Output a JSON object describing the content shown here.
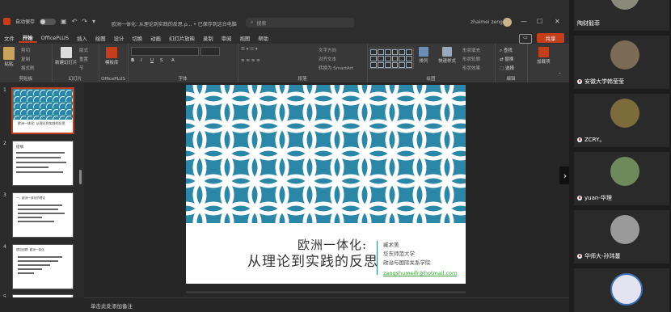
{
  "titlebar": {
    "autosave_label": "自动保存",
    "toggle_state": "关",
    "undo_icon": "undo-icon",
    "redo_icon": "redo-icon",
    "doc_title": "欧洲一体化: 从理论到实践的反思.p... • 已保存到这台电脑",
    "search_placeholder": "搜索",
    "user_name": "zhaimei zeng",
    "minimize": "—",
    "maximize": "☐",
    "close": "✕"
  },
  "ribbon_tabs": [
    "文件",
    "开始",
    "OfficePLUS",
    "插入",
    "绘图",
    "设计",
    "切换",
    "动画",
    "幻灯片放映",
    "录制",
    "审阅",
    "视图",
    "帮助"
  ],
  "active_tab": "开始",
  "comment_icon": "comment-icon",
  "share_label": "共享",
  "ribbon": {
    "clipboard": {
      "paste": "粘贴",
      "cut": "剪切",
      "copy": "复制",
      "format_painter": "格式刷",
      "label": "剪贴板"
    },
    "slides": {
      "new_slide": "新建幻灯片",
      "layout": "版式",
      "reset": "重置",
      "section": "节",
      "label": "幻灯片"
    },
    "officeplus": {
      "template": "模板库",
      "label": "OfficePLUS"
    },
    "font": {
      "label": "字体"
    },
    "paragraph": {
      "text_direction": "文字方向",
      "align_text": "对齐文本",
      "smartart": "转换为 SmartArt",
      "label": "段落"
    },
    "drawing": {
      "arrange": "排列",
      "quick_styles": "快速样式",
      "shape_fill": "形状填充",
      "shape_outline": "形状轮廓",
      "shape_effects": "形状效果",
      "label": "绘图"
    },
    "editing": {
      "find": "查找",
      "replace": "替换",
      "select": "选择",
      "label": "编辑"
    },
    "addin": {
      "label": "加载项"
    }
  },
  "thumbnails": [
    {
      "num": "1",
      "title": "欧洲一体化: 从理论到实践的反思"
    },
    {
      "num": "2",
      "title": "提纲"
    },
    {
      "num": "3",
      "title": "一、欧洲一体化的理论"
    },
    {
      "num": "4",
      "title": "理论回顾: 欧洲一体化"
    },
    {
      "num": "5",
      "title": ""
    }
  ],
  "slide": {
    "title_line1": "欧洲一体化:",
    "title_line2": "从理论到实践的反思",
    "author": "臧术美",
    "university": "华东师范大学",
    "department": "政治与国际关系学院",
    "email": "zangshumeifr@hotmail.com"
  },
  "notes_placeholder": "单击此处添加备注",
  "participants": [
    {
      "name": "陶财毅菲",
      "mic": "mic-muted-icon"
    },
    {
      "name": "安徽大学韩莹莹",
      "mic": "mic-muted-icon"
    },
    {
      "name": "ZCRY。",
      "mic": "mic-muted-icon"
    },
    {
      "name": "yuan-华理",
      "mic": "mic-muted-icon"
    },
    {
      "name": "华师大-孙玮蔓",
      "mic": "mic-muted-icon"
    },
    {
      "name": "",
      "mic": ""
    }
  ],
  "colors": {
    "accent": "#c43e1c",
    "slide_pattern": "#2a87a8",
    "email": "#3a9d3a"
  }
}
